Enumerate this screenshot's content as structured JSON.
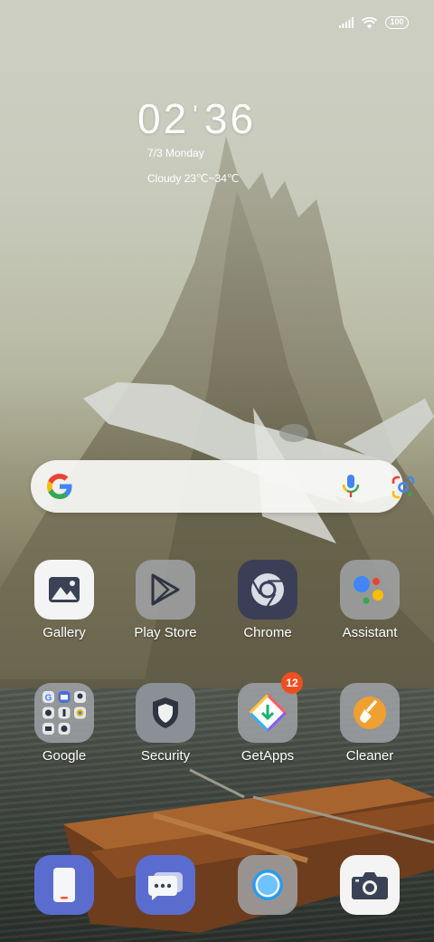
{
  "status_bar": {
    "battery": "100",
    "icons": [
      "signal-icon",
      "wifi-icon",
      "battery-icon"
    ]
  },
  "lockclock": {
    "hour": "02",
    "separator": "'",
    "minute": "36",
    "date": "7/3 Monday",
    "weather": "Cloudy 23℃~34℃"
  },
  "search": {
    "icons": [
      "google-logo-icon",
      "microphone-icon",
      "google-lens-icon"
    ]
  },
  "apps": [
    {
      "label": "Gallery",
      "icon": "gallery-icon"
    },
    {
      "label": "Play Store",
      "icon": "play-store-icon"
    },
    {
      "label": "Chrome",
      "icon": "chrome-icon"
    },
    {
      "label": "Assistant",
      "icon": "assistant-icon"
    },
    {
      "label": "Google",
      "icon": "folder-icon"
    },
    {
      "label": "Security",
      "icon": "shield-icon"
    },
    {
      "label": "GetApps",
      "icon": "getapps-icon",
      "badge": "12"
    },
    {
      "label": "Cleaner",
      "icon": "broom-icon"
    }
  ],
  "dock": [
    {
      "icon": "phone-icon"
    },
    {
      "icon": "messages-icon"
    },
    {
      "icon": "browser-icon"
    },
    {
      "icon": "camera-icon"
    }
  ],
  "colors": {
    "badge": "#ef4f1f",
    "security_tile": "#8b8f96",
    "chrome_tile": "#3a3f57",
    "dock_blue": "#5b6ccf"
  }
}
